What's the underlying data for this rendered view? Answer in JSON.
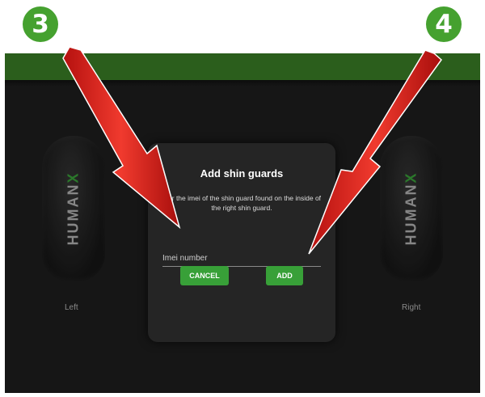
{
  "steps": {
    "left": "3",
    "right": "4"
  },
  "guards": {
    "brand_prefix": "HUMAN",
    "brand_x": "X",
    "left_label": "Left",
    "right_label": "Right"
  },
  "dialog": {
    "title": "Add shin guards",
    "text": "nter the imei of the shin guard found on the inside of the right shin guard.",
    "input_placeholder": "Imei number",
    "input_value": "",
    "cancel_label": "CANCEL",
    "add_label": "ADD"
  },
  "colors": {
    "accent_green": "#38a038",
    "topbar_green": "#2b5e1c",
    "step_badge": "#45a12f",
    "arrow_red": "#e8231f"
  }
}
